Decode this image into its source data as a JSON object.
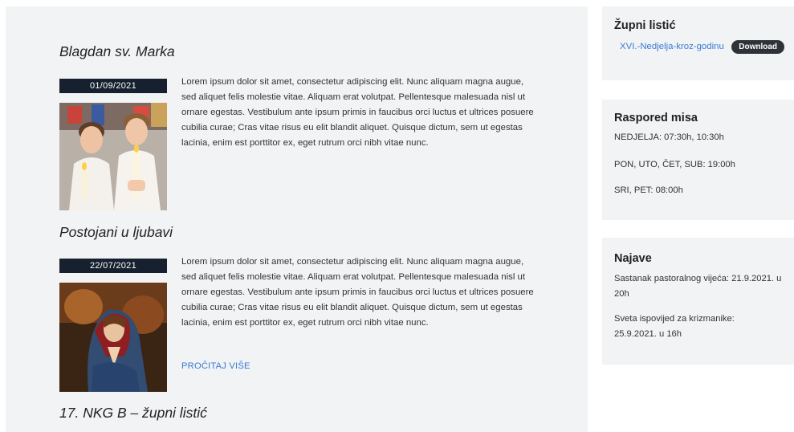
{
  "posts": [
    {
      "title": "Blagdan sv. Marka",
      "date": "01/09/2021",
      "excerpt": "Lorem ipsum dolor sit amet, consectetur adipiscing elit. Nunc aliquam magna augue, sed aliquet felis molestie vitae. Aliquam erat volutpat. Pellentesque malesuada nisl ut ornare egestas. Vestibulum ante ipsum primis in faucibus orci luctus et ultrices posuere cubilia curae; Cras vitae risus eu elit blandit aliquet. Quisque dictum, sem ut egestas lacinia, enim est porttitor ex, eget rutrum orci nibh vitae nunc."
    },
    {
      "title": "Postojani u ljubavi",
      "date": "22/07/2021",
      "excerpt": "Lorem ipsum dolor sit amet, consectetur adipiscing elit. Nunc aliquam magna augue, sed aliquet felis molestie vitae. Aliquam erat volutpat. Pellentesque malesuada nisl ut ornare egestas. Vestibulum ante ipsum primis in faucibus orci luctus et ultrices posuere cubilia curae; Cras vitae risus eu elit blandit aliquet. Quisque dictum, sem ut egestas lacinia, enim est porttitor ex, eget rutrum orci nibh vitae nunc.",
      "read_more": "PROČITAJ VIŠE"
    },
    {
      "title": "17. NKG B – župni listić"
    }
  ],
  "sidebar": {
    "bulletin": {
      "title": "Župni listić",
      "file_link": "XVI.-Nedjelja-kroz-godinu",
      "download_label": "Download"
    },
    "mass_schedule": {
      "title": "Raspored misa",
      "lines": [
        "NEDJELJA: 07:30h, 10:30h",
        "PON, UTO, ČET, SUB: 19:00h",
        "SRI, PET: 08:00h"
      ]
    },
    "announcements": {
      "title": "Najave",
      "lines": [
        "Sastanak pastoralnog vijeća: 21.9.2021. u 20h",
        "Sveta ispovijed za krizmanike: 25.9.2021. u 16h"
      ]
    }
  },
  "colors": {
    "accent_link": "#3a7bd5",
    "date_badge_bg": "#16202e",
    "panel_bg": "#f1f3f4"
  }
}
